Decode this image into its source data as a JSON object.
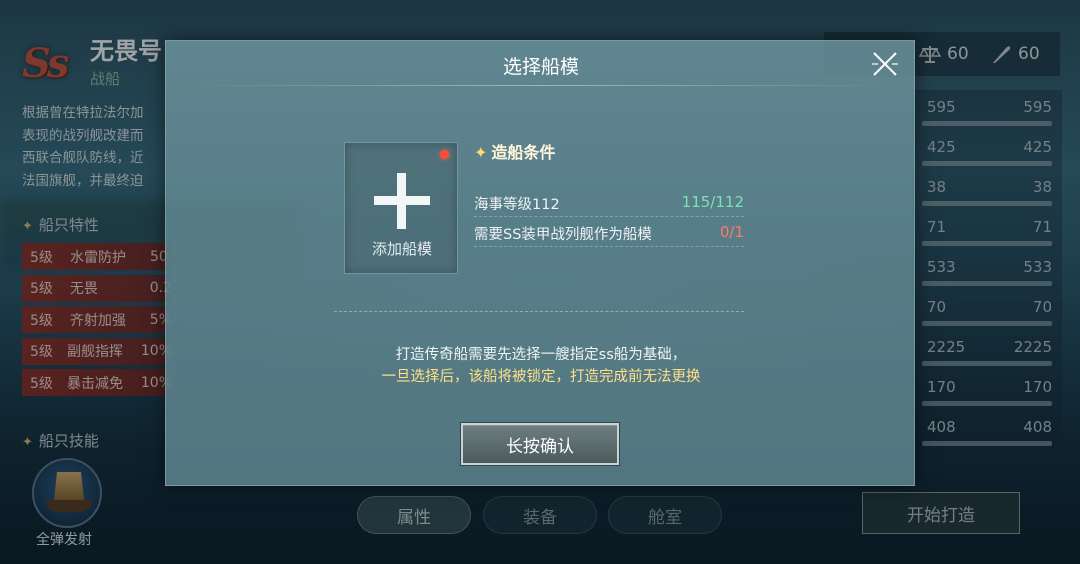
{
  "ship": {
    "rank": "Ss",
    "name": "无畏号",
    "type": "战船",
    "description": "根据曾在特拉法尔加\n表现的战列舰改建而\n西联合舰队防线，近\n法国旗舰，并最终迫"
  },
  "traits": {
    "title": "船只特性",
    "items": [
      {
        "level": "5级",
        "name": "水雷防护",
        "value": "50"
      },
      {
        "level": "5级",
        "name": "无畏",
        "value": "0.2"
      },
      {
        "level": "5级",
        "name": "齐射加强",
        "value": "5%"
      },
      {
        "level": "5级",
        "name": "副舰指挥",
        "value": "10%"
      },
      {
        "level": "5级",
        "name": "暴击减免",
        "value": "10%"
      }
    ]
  },
  "skills": {
    "title": "船只技能",
    "skill_label": "全弹发射",
    "icon": "ship-skill-icon"
  },
  "top_stats": {
    "scale_value": "60",
    "quill_value": "60"
  },
  "attributes": [
    {
      "v1": "595",
      "v2": "595"
    },
    {
      "v1": "425",
      "v2": "425"
    },
    {
      "v1": "38",
      "v2": "38"
    },
    {
      "v1": "71",
      "v2": "71"
    },
    {
      "v1": "533",
      "v2": "533"
    },
    {
      "v1": "70",
      "v2": "70"
    },
    {
      "v1": "2225",
      "v2": "2225"
    },
    {
      "v1": "170",
      "v2": "170"
    },
    {
      "v1": "408",
      "v2": "408"
    }
  ],
  "tabs": [
    {
      "label": "属性"
    },
    {
      "label": "装备"
    },
    {
      "label": "舱室"
    }
  ],
  "start_build_label": "开始打造",
  "modal": {
    "title": "选择船模",
    "add_label": "添加船模",
    "conditions_title": "造船条件",
    "conditions": [
      {
        "label": "海事等级112",
        "value": "115/112",
        "color": "#7ee0b6"
      },
      {
        "label": "需要SS装甲战列舰作为船模",
        "value": "0/1",
        "color": "#ff7a66"
      }
    ],
    "note_line1": "打造传奇船需要先选择一艘指定ss船为基础，",
    "note_line2": "一旦选择后，该船将被锁定，打造完成前无法更换",
    "confirm_label": "长按确认"
  },
  "colors": {
    "accent_gold": "#ffe08a",
    "trait_red": "#962d23",
    "success_green": "#7ee0b6",
    "fail_red": "#ff7a66"
  }
}
